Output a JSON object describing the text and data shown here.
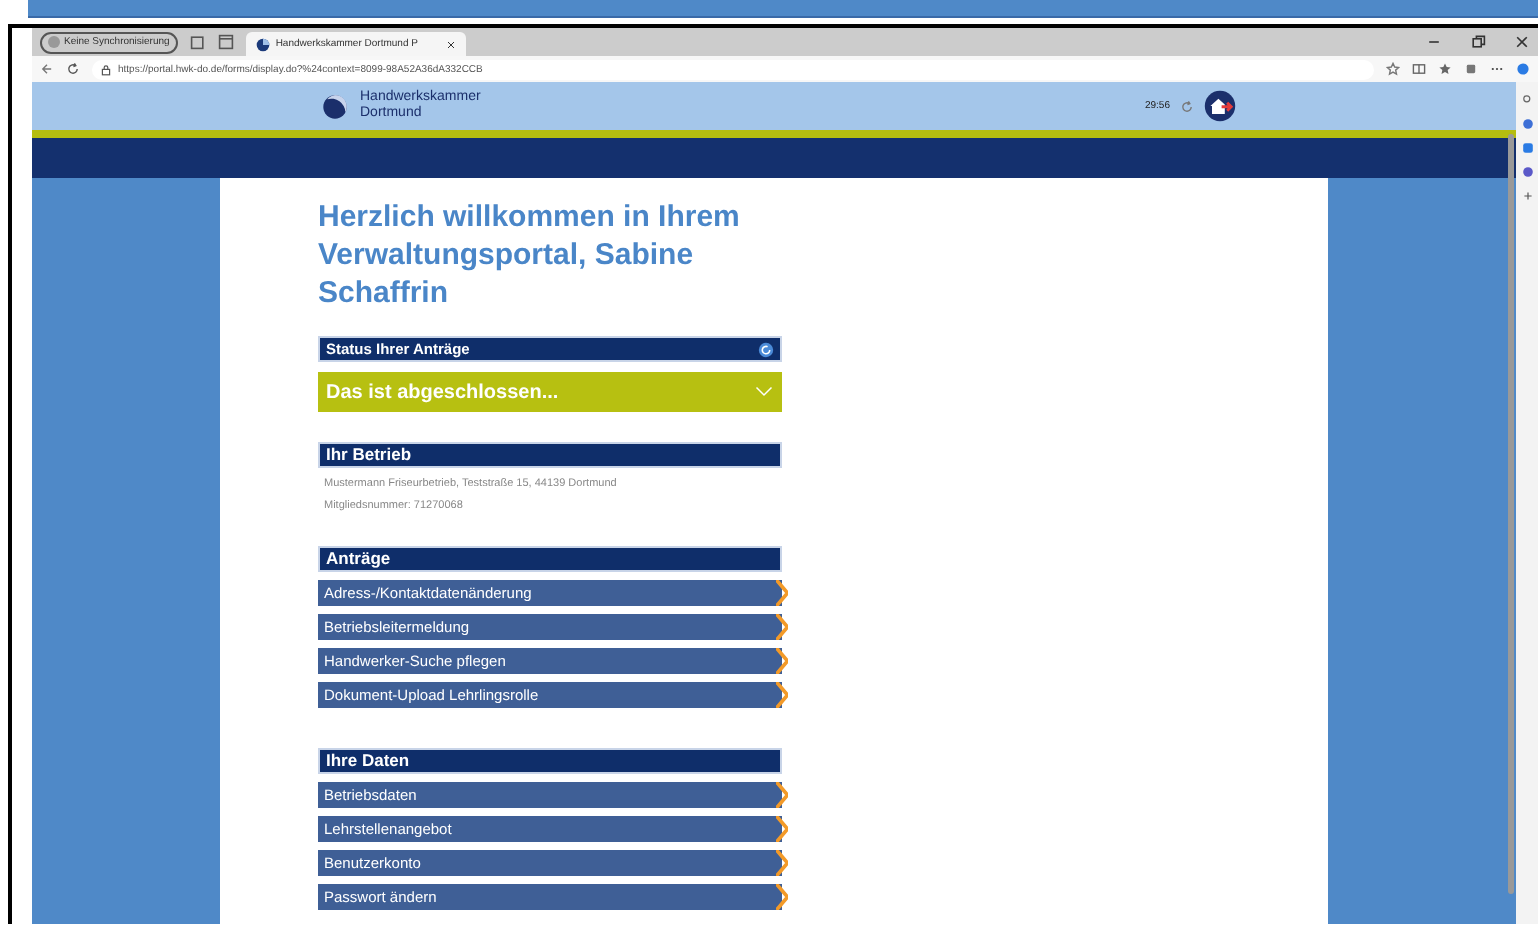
{
  "browser": {
    "profile": "Keine Synchronisierung",
    "tab_title": "Handwerkskammer Dortmund P",
    "url": "https://portal.hwk-do.de/forms/display.do?%24context=8099-98A52A36dA332CCB"
  },
  "header": {
    "org_line1": "Handwerkskammer",
    "org_line2": "Dortmund",
    "timer": "29:56"
  },
  "title": "Herzlich willkommen in Ihrem Verwaltungsportal, Sabine Schaffrin",
  "status": {
    "title": "Status Ihrer Anträge",
    "value": "Das ist abgeschlossen...",
    "expanded": false
  },
  "betrieb": {
    "title": "Ihr Betrieb",
    "lines": [
      "Mustermann Friseurbetrieb, Teststraße 15, 44139 Dortmund",
      "Mitgliedsnummer: 71270068"
    ]
  },
  "sections": [
    {
      "title": "Anträge",
      "items": [
        "Adress-/Kontaktdatenänderung",
        "Betriebsleitermeldung",
        "Handwerker-Suche pflegen",
        "Dokument-Upload Lehrlingsrolle"
      ]
    },
    {
      "title": "Ihre Daten",
      "items": [
        "Betriebsdaten",
        "Lehrstellenangebot",
        "Benutzerkonto",
        "Passwort ändern"
      ]
    }
  ]
}
